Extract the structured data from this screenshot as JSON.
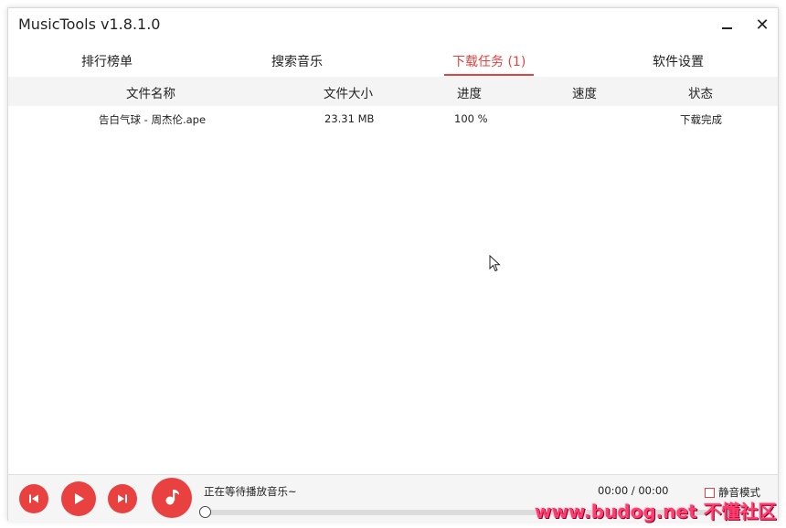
{
  "window": {
    "title": "MusicTools v1.8.1.0",
    "minimize_icon": "minimize-icon",
    "close_glyph": "✕"
  },
  "tabs": [
    {
      "label": "排行榜单"
    },
    {
      "label": "搜索音乐"
    },
    {
      "label": "下载任务 (1)",
      "active": true
    },
    {
      "label": "软件设置"
    }
  ],
  "table": {
    "columns": [
      "文件名称",
      "文件大小",
      "进度",
      "速度",
      "状态"
    ],
    "rows": [
      {
        "name": "告白气球 - 周杰伦.ape",
        "size": "23.31 MB",
        "progress": "100 %",
        "speed": "",
        "status": "下载完成"
      }
    ]
  },
  "player": {
    "status": "正在等待播放音乐~",
    "time": "00:00 / 00:00",
    "mute_label": "静音模式",
    "mute_checked": false,
    "progress_fraction": 0
  },
  "watermark": "www.budog.net 不懂社区",
  "colors": {
    "accent": "#e8413f",
    "header_bg": "#f4f4f4",
    "player_bg": "#f5f5f5"
  }
}
